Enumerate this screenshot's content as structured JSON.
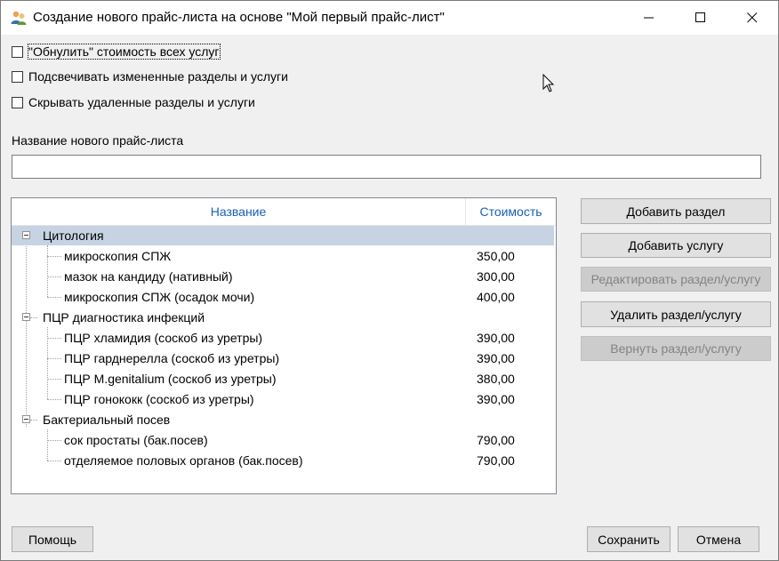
{
  "window": {
    "title": "Создание нового прайс-листа на основе \"Мой первый прайс-лист\"",
    "icon": "app-users-icon"
  },
  "options": {
    "reset_cost": "\"Обнулить\" стоимость всех услуг",
    "highlight_changed": "Подсвечивать измененные разделы и услуги",
    "hide_deleted": "Скрывать удаленные разделы и услуги"
  },
  "name_field": {
    "label": "Название нового прайс-листа",
    "value": ""
  },
  "tree": {
    "columns": {
      "name": "Название",
      "cost": "Стоимость"
    },
    "sections": [
      {
        "title": "Цитология",
        "items": [
          {
            "name": "микроскопия СПЖ",
            "price": "350,00"
          },
          {
            "name": "мазок на кандиду (нативный)",
            "price": "300,00"
          },
          {
            "name": "микроскопия СПЖ (осадок мочи)",
            "price": "400,00"
          }
        ]
      },
      {
        "title": "ПЦР диагностика инфекций",
        "items": [
          {
            "name": "ПЦР хламидия (соскоб из уретры)",
            "price": "390,00"
          },
          {
            "name": "ПЦР гарднерелла (соскоб из уретры)",
            "price": "390,00"
          },
          {
            "name": "ПЦР M.genitalium (соскоб из уретры)",
            "price": "380,00"
          },
          {
            "name": "ПЦР гонококк (соскоб из уретры)",
            "price": "390,00"
          }
        ]
      },
      {
        "title": "Бактериальный посев",
        "items": [
          {
            "name": "сок простаты (бак.посев)",
            "price": "790,00"
          },
          {
            "name": "отделяемое половых органов (бак.посев)",
            "price": "790,00"
          }
        ]
      }
    ]
  },
  "side_buttons": {
    "add_section": "Добавить раздел",
    "add_service": "Добавить услугу",
    "edit": "Редактировать раздел/услугу",
    "delete": "Удалить раздел/услугу",
    "restore": "Вернуть раздел/услугу"
  },
  "footer": {
    "help": "Помощь",
    "save": "Сохранить",
    "cancel": "Отмена"
  }
}
